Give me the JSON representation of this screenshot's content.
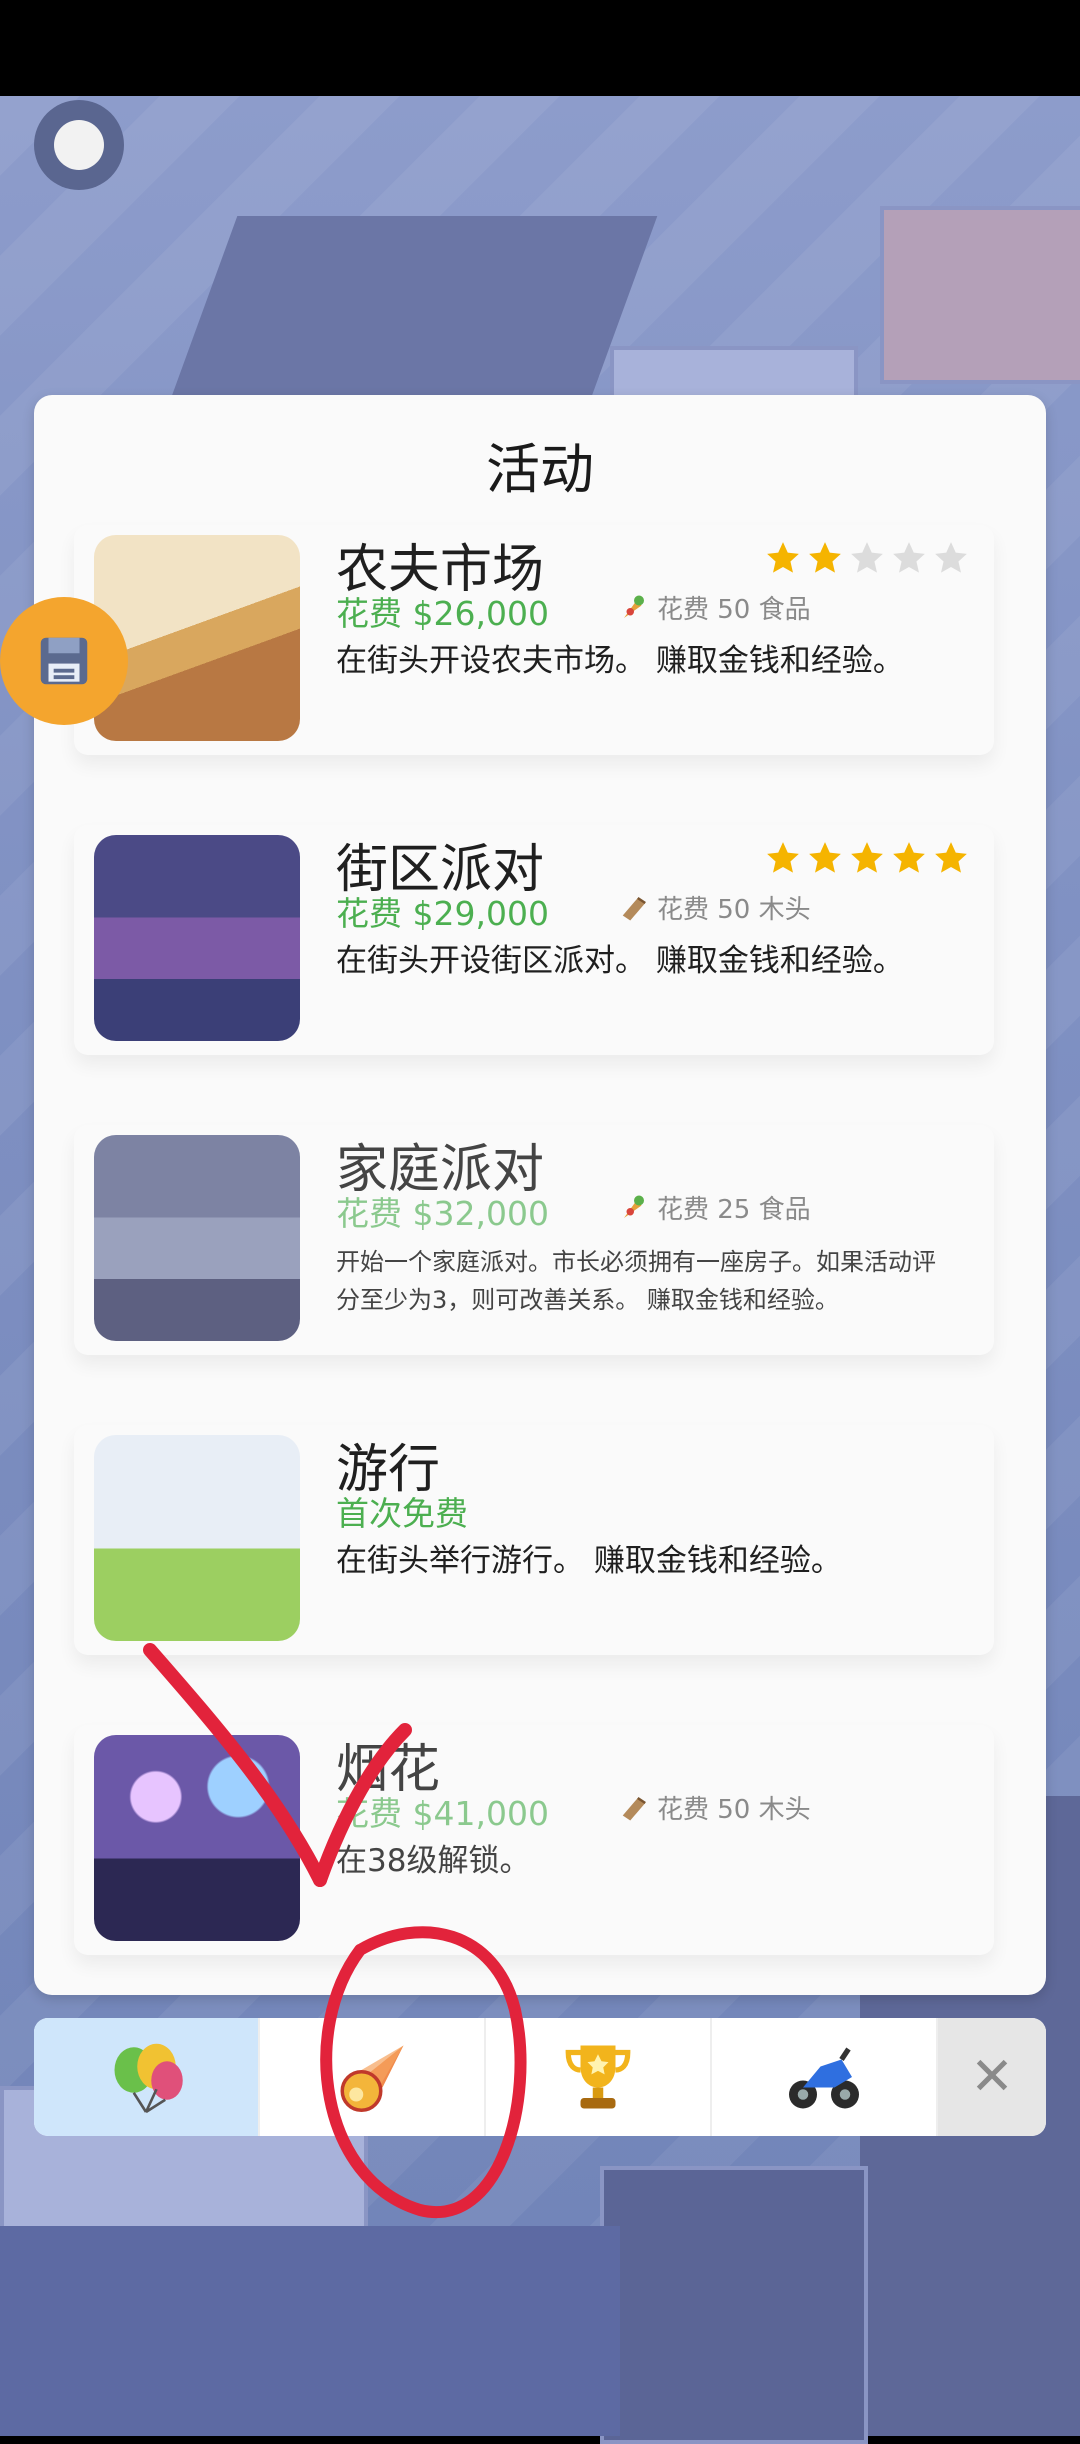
{
  "panel": {
    "title": "活动"
  },
  "activities": [
    {
      "name": "农夫市场",
      "price": "花费 $26,000",
      "cost": "花费 50 食品",
      "cost_icon": "food-icon",
      "desc": "在街头开设农夫市场。 赚取金钱和经验。",
      "stars": 2
    },
    {
      "name": "街区派对",
      "price": "花费 $29,000",
      "cost": "花费 50 木头",
      "cost_icon": "wood-icon",
      "desc": "在街头开设街区派对。 赚取金钱和经验。",
      "stars": 5
    },
    {
      "name": "家庭派对",
      "price": "花费 $32,000",
      "cost": "花费 25 食品",
      "cost_icon": "food-icon",
      "desc": "开始一个家庭派对。市长必须拥有一座房子。如果活动评分至少为3，则可改善关系。 赚取金钱和经验。"
    },
    {
      "name": "游行",
      "price": "首次免费",
      "desc": "在街头举行游行。 赚取金钱和经验。"
    },
    {
      "name": "烟花",
      "price": "花费 $41,000",
      "cost": "花费 50 木头",
      "cost_icon": "wood-icon",
      "desc": "在38级解锁。"
    }
  ],
  "tabs": [
    {
      "icon": "balloons-icon",
      "active": true
    },
    {
      "icon": "meteor-icon",
      "active": false
    },
    {
      "icon": "trophy-icon",
      "active": false
    },
    {
      "icon": "motorcycle-icon",
      "active": false
    }
  ],
  "close_glyph": "✕",
  "colors": {
    "price_green": "#4caf50",
    "star_gold": "#f5b400",
    "star_empty": "#dcdcdc",
    "save_orange": "#f4a52e",
    "annotation_red": "#e2233b"
  }
}
